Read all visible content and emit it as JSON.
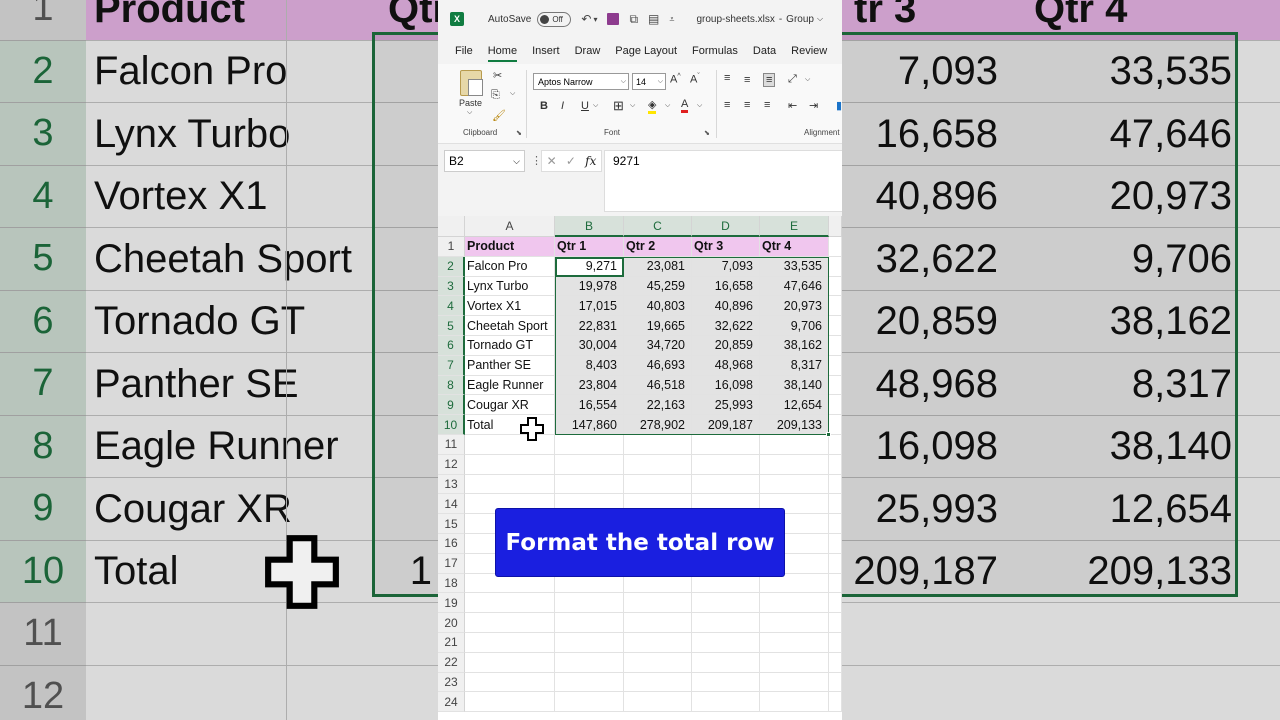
{
  "window": {
    "autosave_label": "AutoSave",
    "autosave_state": "Off",
    "filename": "group-sheets.xlsx",
    "separator": "-",
    "group_label": "Group"
  },
  "menu": [
    "File",
    "Home",
    "Insert",
    "Draw",
    "Page Layout",
    "Formulas",
    "Data",
    "Review",
    "V"
  ],
  "ribbon": {
    "paste_label": "Paste",
    "clipboard_label": "Clipboard",
    "font_name": "Aptos Narrow",
    "font_size": "14",
    "font_label": "Font",
    "alignment_label": "Alignment",
    "bold": "B",
    "italic": "I",
    "underline": "U"
  },
  "formula_bar": {
    "name_box": "B2",
    "formula": "9271",
    "fx": "fx"
  },
  "sheet": {
    "columns": [
      "A",
      "B",
      "C",
      "D",
      "E"
    ],
    "rows": [
      "1",
      "2",
      "3",
      "4",
      "5",
      "6",
      "7",
      "8",
      "9",
      "10",
      "11",
      "12",
      "13",
      "14",
      "15",
      "16",
      "17",
      "18",
      "19",
      "20",
      "21",
      "22",
      "23",
      "24"
    ],
    "header": [
      "Product",
      "Qtr 1",
      "Qtr 2",
      "Qtr 3",
      "Qtr 4"
    ],
    "data": [
      [
        "Falcon Pro",
        "9,271",
        "23,081",
        "7,093",
        "33,535"
      ],
      [
        "Lynx Turbo",
        "19,978",
        "45,259",
        "16,658",
        "47,646"
      ],
      [
        "Vortex X1",
        "17,015",
        "40,803",
        "40,896",
        "20,973"
      ],
      [
        "Cheetah Sport",
        "22,831",
        "19,665",
        "32,622",
        "9,706"
      ],
      [
        "Tornado GT",
        "30,004",
        "34,720",
        "20,859",
        "38,162"
      ],
      [
        "Panther SE",
        "8,403",
        "46,693",
        "48,968",
        "8,317"
      ],
      [
        "Eagle Runner",
        "23,804",
        "46,518",
        "16,098",
        "38,140"
      ],
      [
        "Cougar XR",
        "16,554",
        "22,163",
        "25,993",
        "12,654"
      ],
      [
        "Total",
        "147,860",
        "278,902",
        "209,187",
        "209,133"
      ]
    ]
  },
  "background": {
    "header": [
      "Product",
      "Qtr",
      "tr 3",
      "Qtr 4"
    ],
    "rows": [
      "1",
      "2",
      "3",
      "4",
      "5",
      "6",
      "7",
      "8",
      "9",
      "10",
      "11",
      "12"
    ],
    "products": [
      "Falcon Pro",
      "Lynx Turbo",
      "Vortex X1",
      "Cheetah Sport",
      "Tornado GT",
      "Panther SE",
      "Eagle Runner",
      "Cougar XR",
      "Total"
    ],
    "q3": [
      "7,093",
      "16,658",
      "40,896",
      "32,622",
      "20,859",
      "48,968",
      "16,098",
      "25,993",
      "209,187"
    ],
    "q4": [
      "33,535",
      "47,646",
      "20,973",
      "9,706",
      "38,162",
      "8,317",
      "38,140",
      "12,654",
      "209,133"
    ],
    "partial_total": "1"
  },
  "banner": {
    "text": "Format the total row"
  },
  "colors": {
    "excel_green": "#107c41",
    "header_pink": "#f0c6ee",
    "banner_blue": "#1a1fe0"
  }
}
